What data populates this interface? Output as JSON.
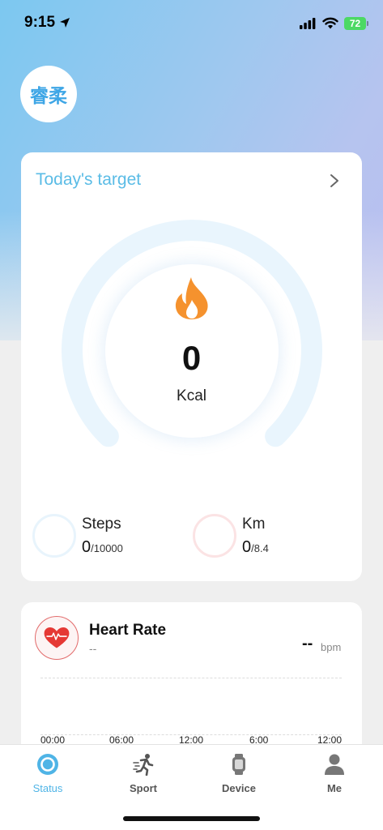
{
  "status_bar": {
    "time": "9:15",
    "battery": "72"
  },
  "profile": {
    "avatar_text": "睿柔"
  },
  "target_card": {
    "title": "Today's target",
    "calories": {
      "value": "0",
      "unit": "Kcal"
    },
    "steps": {
      "label": "Steps",
      "value": "0",
      "goal": "/10000"
    },
    "km": {
      "label": "Km",
      "value": "0",
      "goal": "/8.4"
    }
  },
  "heart_rate": {
    "title": "Heart Rate",
    "subtitle": "--",
    "value": "--",
    "unit": "bpm",
    "x_ticks": [
      "00:00",
      "06:00",
      "12:00",
      "6:00",
      "12:00"
    ]
  },
  "tabs": [
    {
      "label": "Status",
      "icon": "status-ring-icon",
      "active": true
    },
    {
      "label": "Sport",
      "icon": "running-person-icon",
      "active": false
    },
    {
      "label": "Device",
      "icon": "watch-icon",
      "active": false
    },
    {
      "label": "Me",
      "icon": "person-icon",
      "active": false
    }
  ],
  "colors": {
    "accent": "#4fb4e6",
    "flame": "#f5922e",
    "heart": "#e53935",
    "gauge_track": "#e9f5fd"
  }
}
